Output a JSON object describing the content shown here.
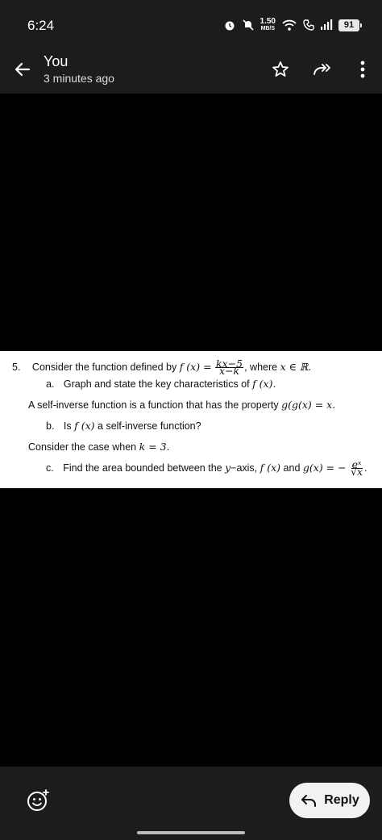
{
  "status_bar": {
    "time": "6:24",
    "speed_value": "1.50",
    "speed_unit": "MB/S",
    "battery": "91"
  },
  "app_bar": {
    "sender": "You",
    "time_ago": "3 minutes ago",
    "icons": [
      "back-arrow-icon",
      "star-icon",
      "forward-all-icon",
      "more-vert-icon"
    ]
  },
  "document": {
    "q_number": "5.",
    "q_intro_pre": "Consider the function defined by",
    "q_fx": "f (x) =",
    "q_frac_num": "kx−5",
    "q_frac_den": "x−k",
    "q_intro_post": ", where",
    "q_domain": "x ∈ ℝ.",
    "part_a_label": "a.",
    "part_a_text": "Graph and state the key characteristics of",
    "part_a_math": "f (x).",
    "self_inverse_text": "A self-inverse function is a function that has the property",
    "self_inverse_math": "g(g(x) = x.",
    "part_b_label": "b.",
    "part_b_pre": "Is",
    "part_b_math": "f (x)",
    "part_b_post": "a self-inverse function?",
    "case_text": "Consider the case when",
    "case_math": "k = 3.",
    "part_c_label": "c.",
    "part_c_pre": "Find the area bounded between the",
    "part_c_y": "y",
    "part_c_mid": "−axis,",
    "part_c_fx": "f (x)",
    "part_c_and": "and",
    "part_c_gx": "g(x) = −",
    "part_c_frac_num": "eˣ",
    "part_c_frac_den": "√x",
    "part_c_end": "."
  },
  "bottom": {
    "reply_label": "Reply"
  }
}
